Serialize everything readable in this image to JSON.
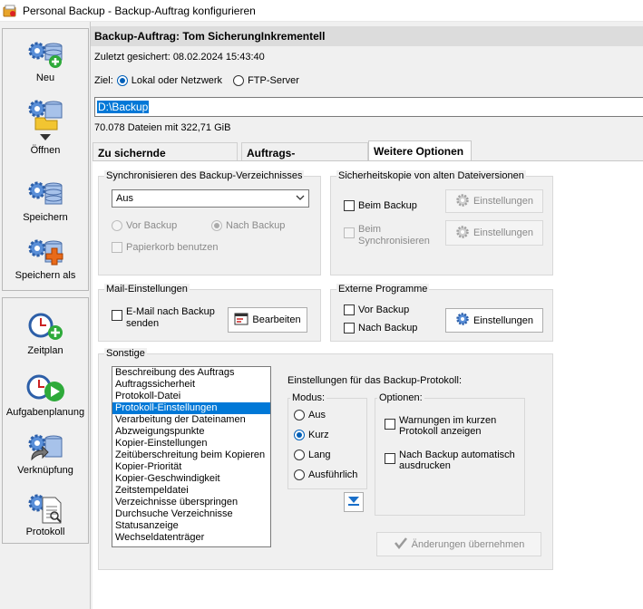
{
  "window": {
    "title": "Personal Backup - Backup-Auftrag konfigurieren"
  },
  "sidebar": {
    "items": [
      {
        "label": "Neu",
        "icon": "gear-new-icon"
      },
      {
        "label": "Öffnen",
        "icon": "gear-open-icon"
      },
      {
        "label": "Speichern",
        "icon": "gear-save-icon"
      },
      {
        "label": "Speichern als",
        "icon": "gear-save-as-icon"
      },
      {
        "label": "Zeitplan",
        "icon": "clock-add-icon"
      },
      {
        "label": "Aufgabenplanung",
        "icon": "clock-play-icon"
      },
      {
        "label": "Verknüpfung",
        "icon": "gear-shortcut-icon"
      },
      {
        "label": "Protokoll",
        "icon": "gear-log-icon"
      }
    ]
  },
  "header": {
    "job_title": "Backup-Auftrag: Tom SicherungInkrementell",
    "last_saved": "Zuletzt gesichert:  08.02.2024 15:43:40"
  },
  "target": {
    "label": "Ziel:",
    "option_local": "Lokal oder Netzwerk",
    "option_ftp": "FTP-Server",
    "selected": "local",
    "path": "D:\\Backup",
    "summary": "70.078 Dateien mit 322,71 GiB"
  },
  "tabs": [
    {
      "label": "Zu sichernde Verzeichnisse",
      "active": false
    },
    {
      "label": "Auftrags-Einstellungen",
      "active": false
    },
    {
      "label": "Weitere Optionen",
      "active": true
    }
  ],
  "sync": {
    "title": "Synchronisieren des Backup-Verzeichnisses",
    "select_value": "Aus",
    "before_label": "Vor Backup",
    "after_label": "Nach Backup",
    "recycle_label": "Papierkorb benutzen"
  },
  "safety": {
    "title": "Sicherheitskopie von alten Dateiversionen",
    "backup_label": "Beim Backup",
    "sync_label_1": "Beim",
    "sync_label_2": "Synchronisieren",
    "settings_label": "Einstellungen"
  },
  "mail": {
    "title": "Mail-Einstellungen",
    "checkbox_label_1": "E-Mail nach Backup",
    "checkbox_label_2": "senden",
    "edit_label": "Bearbeiten"
  },
  "external": {
    "title": "Externe Programme",
    "before_label": "Vor Backup",
    "after_label": "Nach Backup",
    "settings_label": "Einstellungen"
  },
  "misc": {
    "title": "Sonstige",
    "list_items": [
      "Beschreibung des Auftrags",
      "Auftragssicherheit",
      "Protokoll-Datei",
      "Protokoll-Einstellungen",
      "Verarbeitung der Dateinamen",
      "Abzweigungspunkte",
      "Kopier-Einstellungen",
      "Zeitüberschreitung beim Kopieren",
      "Kopier-Priorität",
      "Kopier-Geschwindigkeit",
      "Zeitstempeldatei",
      "Verzeichnisse überspringen",
      "Durchsuche Verzeichnisse",
      "Statusanzeige",
      "Wechseldatenträger"
    ],
    "selected_index": 3,
    "protocol_heading": "Einstellungen für das Backup-Protokoll:",
    "mode_title": "Modus:",
    "modes": [
      "Aus",
      "Kurz",
      "Lang",
      "Ausführlich"
    ],
    "selected_mode": 1,
    "options_title": "Optionen:",
    "opt_warn_1": "Warnungen im kurzen",
    "opt_warn_2": "Protokoll anzeigen",
    "opt_print_1": "Nach Backup automatisch",
    "opt_print_2": "ausdrucken",
    "apply_label": "Änderungen übernehmen"
  },
  "colors": {
    "accent": "#0078d7",
    "selection": "#0078d7"
  }
}
